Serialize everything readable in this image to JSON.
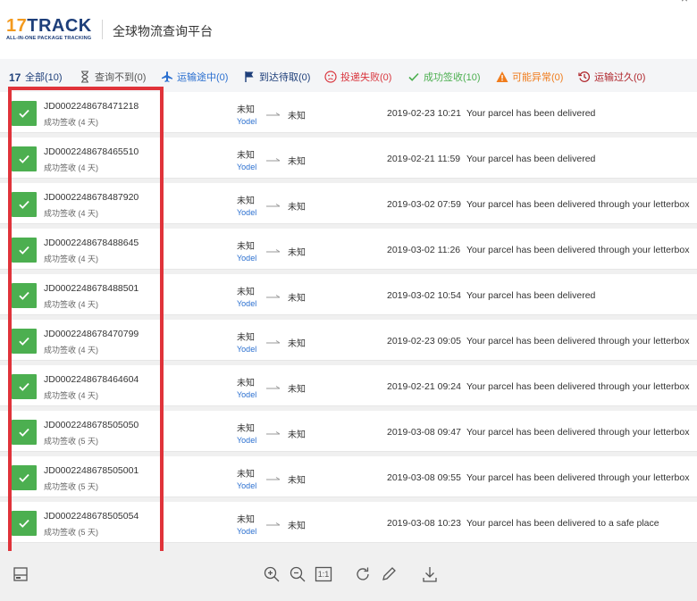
{
  "header": {
    "logo_main_num": "17",
    "logo_main_text": "TRACK",
    "logo_sub": "ALL-IN-ONE PACKAGE TRACKING",
    "platform_title": "全球物流查询平台"
  },
  "tabs": [
    {
      "label": "全部(10)",
      "icon": "17-logo-icon",
      "color": "#1e3f7a",
      "active": true
    },
    {
      "label": "查询不到(0)",
      "icon": "hourglass-icon",
      "color": "#555555"
    },
    {
      "label": "运输途中(0)",
      "icon": "airplane-icon",
      "color": "#2a6fd0"
    },
    {
      "label": "到达待取(0)",
      "icon": "flag-icon",
      "color": "#1e3f7a"
    },
    {
      "label": "投递失败(0)",
      "icon": "sad-face-icon",
      "color": "#d9363e"
    },
    {
      "label": "成功签收(10)",
      "icon": "check-icon",
      "color": "#4caf50"
    },
    {
      "label": "可能异常(0)",
      "icon": "warning-icon",
      "color": "#f07c1c"
    },
    {
      "label": "运输过久(0)",
      "icon": "history-clock-icon",
      "color": "#b0282e"
    }
  ],
  "rows": [
    {
      "tracking": "JD0002248678471218",
      "status": "成功签收 (4 天)",
      "origin": "未知",
      "carrier": "Yodel",
      "dest": "未知",
      "time": "2019-02-23 10:21",
      "event": "Your parcel has been delivered"
    },
    {
      "tracking": "JD0002248678465510",
      "status": "成功签收 (4 天)",
      "origin": "未知",
      "carrier": "Yodel",
      "dest": "未知",
      "time": "2019-02-21 11:59",
      "event": "Your parcel has been delivered"
    },
    {
      "tracking": "JD0002248678487920",
      "status": "成功签收 (4 天)",
      "origin": "未知",
      "carrier": "Yodel",
      "dest": "未知",
      "time": "2019-03-02 07:59",
      "event": "Your parcel has been delivered through your letterbox"
    },
    {
      "tracking": "JD0002248678488645",
      "status": "成功签收 (4 天)",
      "origin": "未知",
      "carrier": "Yodel",
      "dest": "未知",
      "time": "2019-03-02 11:26",
      "event": "Your parcel has been delivered through your letterbox"
    },
    {
      "tracking": "JD0002248678488501",
      "status": "成功签收 (4 天)",
      "origin": "未知",
      "carrier": "Yodel",
      "dest": "未知",
      "time": "2019-03-02 10:54",
      "event": "Your parcel has been delivered"
    },
    {
      "tracking": "JD0002248678470799",
      "status": "成功签收 (4 天)",
      "origin": "未知",
      "carrier": "Yodel",
      "dest": "未知",
      "time": "2019-02-23 09:05",
      "event": "Your parcel has been delivered through your letterbox"
    },
    {
      "tracking": "JD0002248678464604",
      "status": "成功签收 (4 天)",
      "origin": "未知",
      "carrier": "Yodel",
      "dest": "未知",
      "time": "2019-02-21 09:24",
      "event": "Your parcel has been delivered through your letterbox"
    },
    {
      "tracking": "JD0002248678505050",
      "status": "成功签收 (5 天)",
      "origin": "未知",
      "carrier": "Yodel",
      "dest": "未知",
      "time": "2019-03-08 09:47",
      "event": "Your parcel has been delivered through your letterbox"
    },
    {
      "tracking": "JD0002248678505001",
      "status": "成功签收 (5 天)",
      "origin": "未知",
      "carrier": "Yodel",
      "dest": "未知",
      "time": "2019-03-08 09:55",
      "event": "Your parcel has been delivered through your letterbox"
    },
    {
      "tracking": "JD0002248678505054",
      "status": "成功签收 (5 天)",
      "origin": "未知",
      "carrier": "Yodel",
      "dest": "未知",
      "time": "2019-03-08 10:23",
      "event": "Your parcel has been delivered to a safe place"
    }
  ],
  "toolbar": {
    "icons": [
      "panel-toggle-icon",
      "zoom-in-icon",
      "zoom-out-icon",
      "actual-size-icon",
      "rotate-icon",
      "edit-pen-icon",
      "download-icon"
    ],
    "actual_size_label": "1:1"
  },
  "colors": {
    "accent": "#2a5ba8",
    "success": "#4caf50",
    "highlight": "#e0333a"
  }
}
